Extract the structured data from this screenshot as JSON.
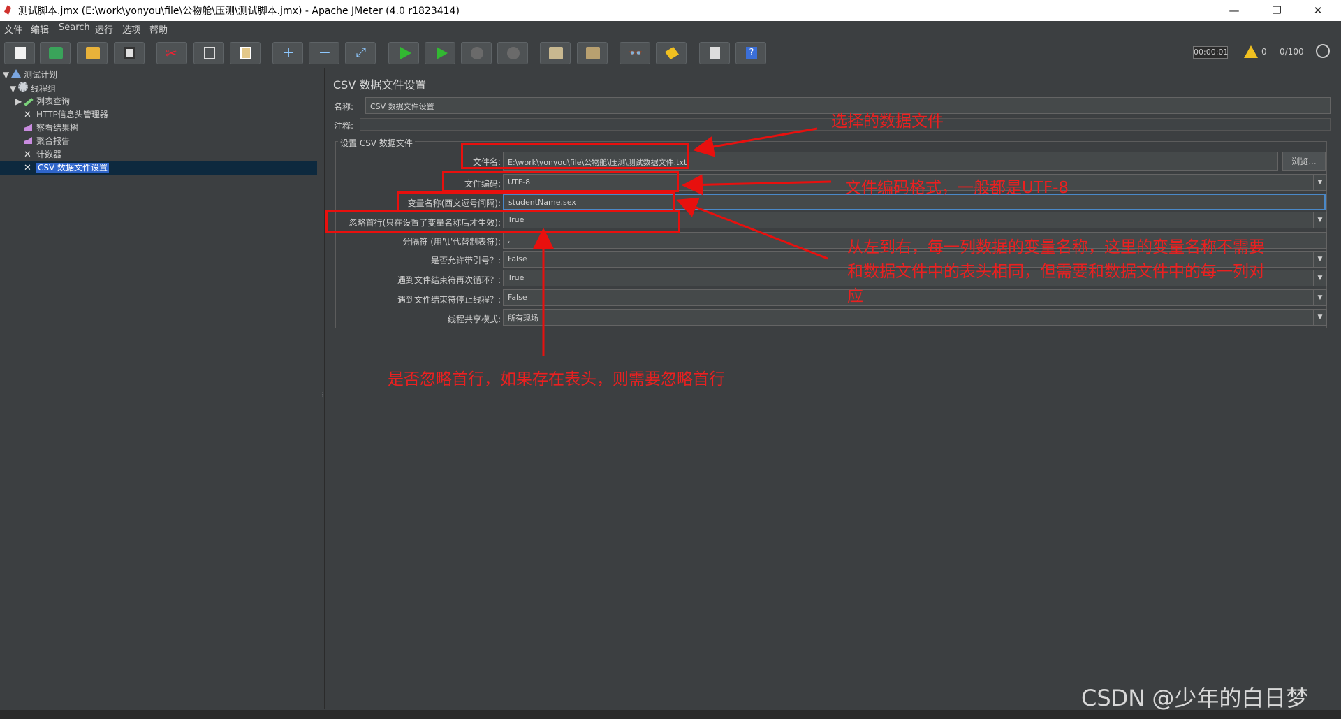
{
  "window": {
    "title": "测试脚本.jmx (E:\\work\\yonyou\\file\\公物舱\\压测\\测试脚本.jmx) - Apache JMeter (4.0 r1823414)",
    "minimize": "—",
    "restore": "❐",
    "close": "✕"
  },
  "menu": [
    "文件",
    "编辑",
    "Search",
    "运行",
    "选项",
    "帮助"
  ],
  "toolbar": {
    "icons": [
      "new-icon",
      "templates-icon",
      "open-icon",
      "save-icon",
      "cut-icon",
      "copy-icon",
      "paste-icon",
      "expand-icon",
      "collapse-icon",
      "toggle-icon",
      "start-icon",
      "start-no-pause-icon",
      "stop-icon",
      "shutdown-icon",
      "clear-icon",
      "clear-all-icon",
      "search-icon",
      "reset-search-icon",
      "function-helper-icon",
      "help-icon"
    ],
    "timer": "00:00:01",
    "warnings": "0",
    "threads": "0/100"
  },
  "tree": {
    "items": [
      {
        "label": "测试计划"
      },
      {
        "label": "线程组"
      },
      {
        "label": "列表查询"
      },
      {
        "label": "HTTP信息头管理器"
      },
      {
        "label": "察看结果树"
      },
      {
        "label": "聚合报告"
      },
      {
        "label": "计数器"
      },
      {
        "label": "CSV 数据文件设置"
      }
    ]
  },
  "panel": {
    "title": "CSV 数据文件设置",
    "name_label": "名称:",
    "name_value": "CSV 数据文件设置",
    "comment_label": "注释:",
    "comment_value": "",
    "group_title": "设置 CSV 数据文件",
    "browse": "浏览...",
    "rows": [
      {
        "label": "文件名:",
        "value": "E:\\work\\yonyou\\file\\公物舱\\压测\\测试数据文件.txt"
      },
      {
        "label": "文件编码:",
        "value": "UTF-8"
      },
      {
        "label": "变量名称(西文逗号间隔):",
        "value": "studentName,sex"
      },
      {
        "label": "忽略首行(只在设置了变量名称后才生效):",
        "value": "True"
      },
      {
        "label": "分隔符 (用'\\t'代替制表符):",
        "value": ","
      },
      {
        "label": "是否允许带引号？:",
        "value": "False"
      },
      {
        "label": "遇到文件结束符再次循环？:",
        "value": "True"
      },
      {
        "label": "遇到文件结束符停止线程？:",
        "value": "False"
      },
      {
        "label": "线程共享模式:",
        "value": "所有现场"
      }
    ]
  },
  "annotations": {
    "a1": "选择的数据文件",
    "a2": "文件编码格式，一般都是UTF-8",
    "a3_line1": "从左到右，每一列数据的变量名称，这里的变量名称不需要",
    "a3_line2": "和数据文件中的表头相同，但需要和数据文件中的每一列对",
    "a3_line3": "应",
    "a4": "是否忽略首行，如果存在表头，则需要忽略首行"
  },
  "watermark": "CSDN @少年的白日梦",
  "colors": {
    "annotation": "#e8100e",
    "selection": "#2f65ca"
  }
}
